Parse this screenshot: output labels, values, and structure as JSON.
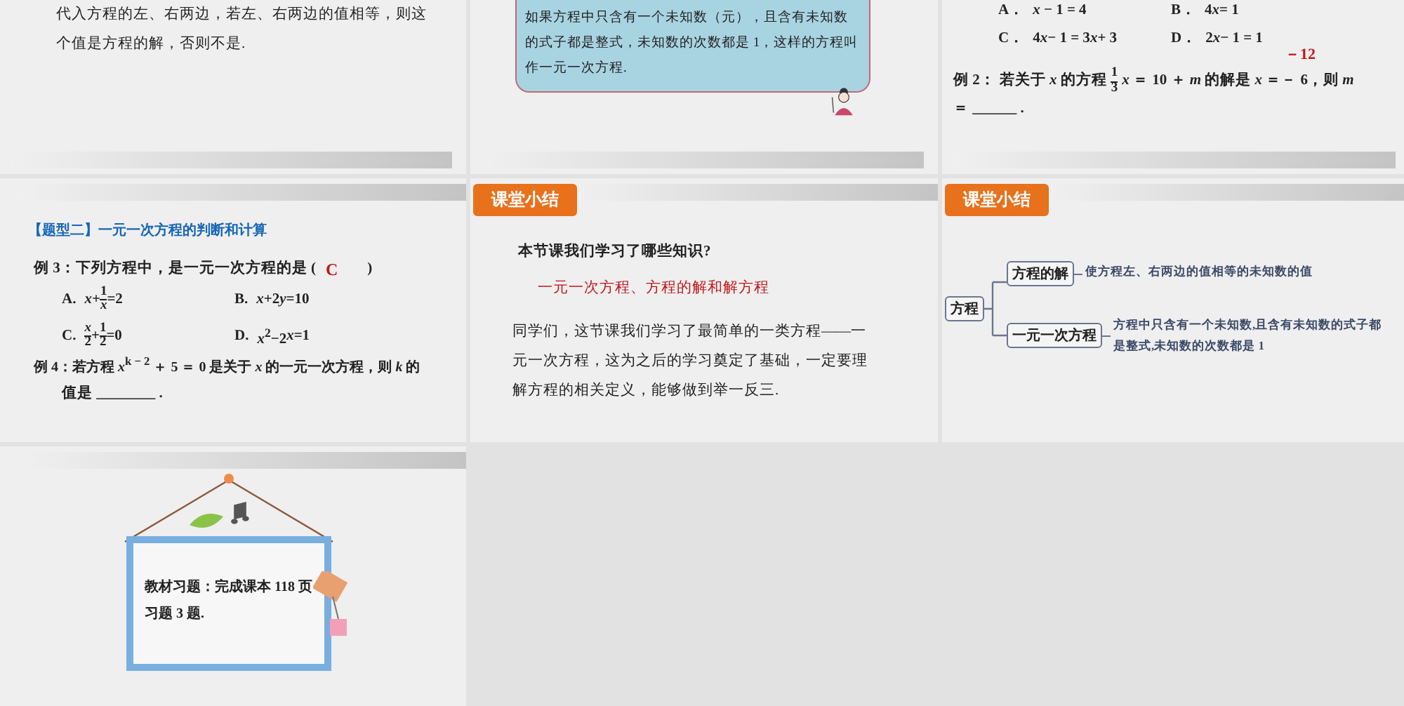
{
  "slides": [
    {
      "kind": "text",
      "paragraph": "代入方程的左、右两边，若左、右两边的值相等，则这个值是方程的解，否则不是."
    },
    {
      "kind": "definition",
      "text": "如果方程中只含有一个未知数（元），且含有未知数的式子都是整式，未知数的次数都是 1，这样的方程叫作一元一次方程."
    },
    {
      "kind": "choices",
      "options": [
        {
          "label": "A．",
          "expr": [
            {
              "t": "*x* − 1 = 4"
            }
          ]
        },
        {
          "label": "B．",
          "expr": [
            {
              "t": "4"
            },
            {
              "i": "x"
            },
            {
              "t": " = 1"
            }
          ]
        },
        {
          "label": "C．",
          "expr": [
            {
              "t": "4"
            },
            {
              "i": "x"
            },
            {
              "t": " − 1 = 3"
            },
            {
              "i": "x"
            },
            {
              "t": " + 3"
            }
          ]
        },
        {
          "label": "D．",
          "expr": [
            {
              "t": "2"
            },
            {
              "i": "x"
            },
            {
              "t": " − 1 = 1"
            }
          ]
        }
      ],
      "example": {
        "label": "例 2：",
        "expr": [
          {
            "t": "若关于 *x* 的方程"
          },
          {
            "num": "1",
            "den": "3"
          },
          {
            "t": "*x* ＝ 10 ＋ *m* 的解是 *x* ＝－ 6，则 *m*"
          }
        ],
        "line2": "＝ ______ .",
        "answer": "－12"
      }
    },
    {
      "kind": "exercises",
      "heading": "【题型二】一元一次方程的判断和计算",
      "question": "例 3：下列方程中，是一元一次方程的是 (",
      "answer": "C",
      "close": ")",
      "options": [
        {
          "label": "A.",
          "expr": [
            {
              "t": "*x*+"
            },
            {
              "num": "1",
              "den": "*x*"
            },
            {
              "t": "=2"
            }
          ]
        },
        {
          "label": "B.",
          "expr": [
            {
              "i": "x"
            },
            {
              "t": "+2"
            },
            {
              "i": "y"
            },
            {
              "t": "=10"
            }
          ]
        },
        {
          "label": "C.",
          "expr": [
            {
              "num": "*x*",
              "den": "2"
            },
            {
              "t": "+"
            },
            {
              "num": "1",
              "den": "2"
            },
            {
              "t": "=0"
            }
          ]
        },
        {
          "label": "D.",
          "expr": [
            {
              "t": "*x*$^{2}$−2"
            },
            {
              "i": "x"
            },
            {
              "t": "=1"
            }
          ]
        }
      ],
      "example": "例 4：若方程 *x*$^{k − 2}$ ＋ 5 ＝ 0 是关于 *x* 的一元一次方程，则 *k* 的",
      "line2": "值是 ________ ."
    },
    {
      "kind": "summary",
      "tag": "课堂小结",
      "question": "本节课我们学习了哪些知识?",
      "answer": "一元一次方程、方程的解和解方程",
      "paragraph": "同学们，这节课我们学习了最简单的一类方程——一元一次方程，这为之后的学习奠定了基础，一定要理解方程的相关定义，能够做到举一反三."
    },
    {
      "kind": "mindmap",
      "tag": "课堂小结",
      "root": "方程",
      "branches": [
        {
          "label": "方程的解",
          "desc": "使方程左、右两边的值相等的未知数的值"
        },
        {
          "label": "一元一次方程",
          "desc": "方程中只含有一个未知数,且含有未知数的式子都是整式,未知数的次数都是 1"
        }
      ]
    },
    {
      "kind": "board",
      "text": "教材习题：完成课本 118 页习题 3 题."
    }
  ]
}
